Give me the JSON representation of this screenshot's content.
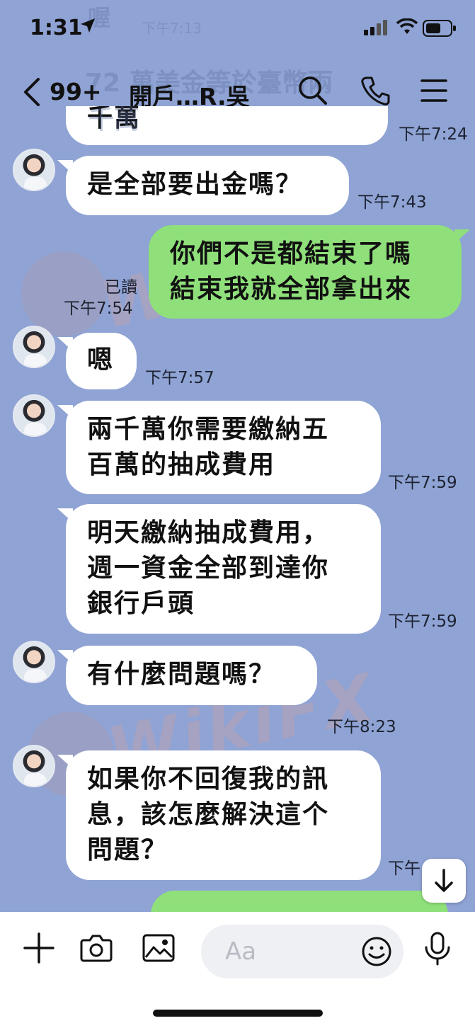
{
  "status_bar": {
    "time": "1:31"
  },
  "header": {
    "back_count": "99+",
    "title": "開戶…R.吳",
    "ghost_line1": "72 萬美金等於臺幣兩",
    "ghost_line2": "千萬",
    "ghost_top": "喔",
    "ghost_top_time": "下午7:13"
  },
  "messages": [
    {
      "id": "m0",
      "direction": "in",
      "lines": [
        "千萬"
      ],
      "time": "下午7:24"
    },
    {
      "id": "m1",
      "direction": "in",
      "lines": [
        "是全部要出金嗎？"
      ],
      "time": "下午7:43"
    },
    {
      "id": "m2",
      "direction": "out",
      "lines": [
        "你們不是都結束了嗎",
        "結束我就全部拿出來"
      ],
      "read": "已讀",
      "time": "下午7:54"
    },
    {
      "id": "m3",
      "direction": "in",
      "lines": [
        "嗯"
      ],
      "time": "下午7:57"
    },
    {
      "id": "m4",
      "direction": "in",
      "lines": [
        "兩千萬你需要繳納五",
        "百萬的抽成費用"
      ],
      "time": "下午7:59"
    },
    {
      "id": "m5",
      "direction": "in",
      "lines": [
        "明天繳納抽成費用，",
        "週一資金全部到達你",
        "銀行戶頭"
      ],
      "time": "下午7:59"
    },
    {
      "id": "m6",
      "direction": "in",
      "lines": [
        "有什麼問題嗎？"
      ],
      "time": "下午8:23"
    },
    {
      "id": "m7",
      "direction": "in",
      "lines": [
        "如果你不回復我的訊",
        "息，該怎麼解決這个",
        "問題？"
      ],
      "time": "下午"
    }
  ],
  "watermark": {
    "text": "WikiFX"
  },
  "input": {
    "placeholder": "Aa"
  },
  "icons": {
    "status": [
      "location-arrow-icon",
      "signal-icon",
      "wifi-icon",
      "battery-icon"
    ],
    "header": [
      "back-chevron-icon",
      "search-icon",
      "phone-icon",
      "menu-icon"
    ],
    "input": [
      "plus-icon",
      "camera-icon",
      "image-icon",
      "emoji-icon",
      "microphone-icon"
    ],
    "scroll": "arrow-down-icon"
  },
  "colors": {
    "background": "#8fa3d4",
    "outgoing_bubble": "#8fe07a",
    "incoming_bubble": "#ffffff"
  }
}
